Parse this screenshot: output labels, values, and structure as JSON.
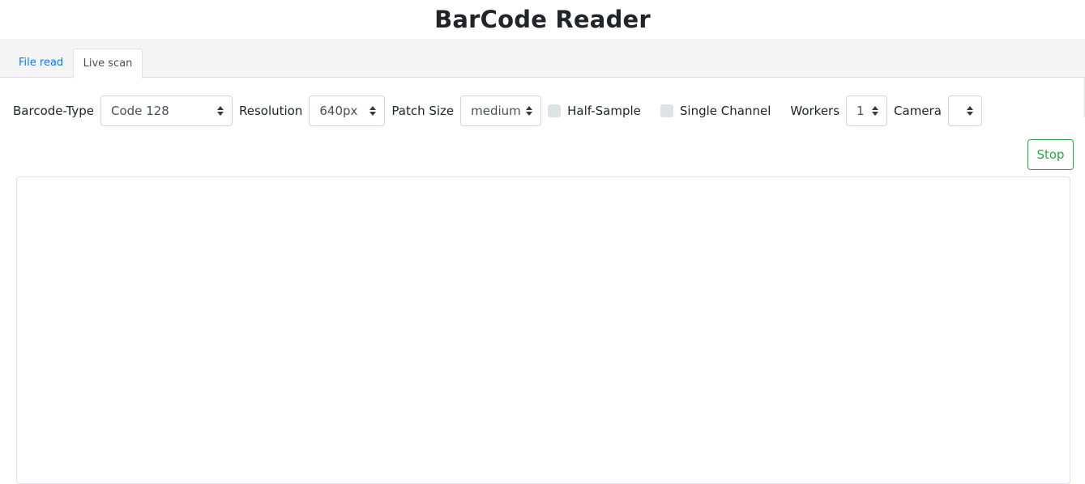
{
  "app": {
    "title": "BarCode Reader"
  },
  "tabs": [
    {
      "label": "File read",
      "active": false
    },
    {
      "label": "Live scan",
      "active": true
    }
  ],
  "controls": {
    "barcode_type": {
      "label": "Barcode-Type",
      "value": "Code 128"
    },
    "resolution": {
      "label": "Resolution",
      "value": "640px"
    },
    "patch_size": {
      "label": "Patch Size",
      "value": "medium"
    },
    "half_sample": {
      "label": "Half-Sample",
      "checked": false
    },
    "single_channel": {
      "label": "Single Channel",
      "checked": false
    },
    "workers": {
      "label": "Workers",
      "value": "1"
    },
    "camera": {
      "label": "Camera",
      "value": ""
    }
  },
  "actions": {
    "stop_label": "Stop"
  },
  "colors": {
    "link": "#007bff",
    "success": "#28a745"
  }
}
